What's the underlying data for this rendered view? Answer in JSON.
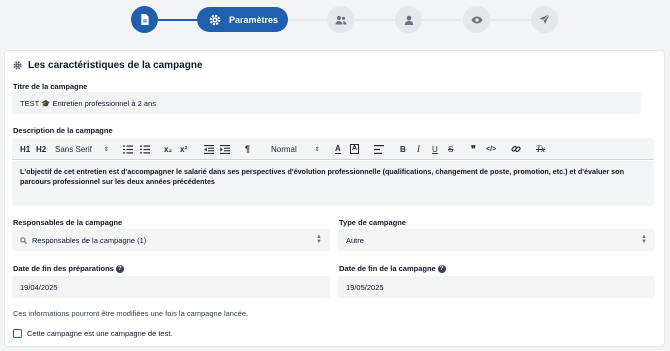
{
  "stepper": {
    "active_step_label": "Paramètres",
    "steps": [
      {
        "icon": "document-icon",
        "state": "completed"
      },
      {
        "icon": "gear-icon",
        "state": "active"
      },
      {
        "icon": "users-icon",
        "state": "pending"
      },
      {
        "icon": "user-icon",
        "state": "pending"
      },
      {
        "icon": "eye-icon",
        "state": "pending"
      },
      {
        "icon": "send-icon",
        "state": "pending"
      }
    ]
  },
  "section": {
    "title": "Les caractéristiques de la campagne"
  },
  "campaign_title": {
    "label": "Titre de la campagne",
    "value": "TEST 🎓 Entretien professionnel à 2 ans"
  },
  "description": {
    "label": "Description de la campagne",
    "value": "L'objectif de cet entretien est d'accompagner le salarié dans ses perspectives d'évolution professionnelle (qualifications, changement de poste, promotion, etc.) et d'évaluer son parcours professionnel sur les deux années précédentes",
    "toolbar": {
      "h1": "H1",
      "h2": "H2",
      "font": "Sans Serif",
      "subscript": "x₂",
      "superscript": "x²",
      "size": "Normal",
      "bold": "B",
      "italic": "I",
      "underline": "U",
      "strike": "S",
      "quote": "❞",
      "code": "</>",
      "clear": "Tx"
    }
  },
  "owners": {
    "label": "Responsables de la campagne",
    "value": "Responsables de la campagne (1)"
  },
  "campaign_type": {
    "label": "Type de campagne",
    "value": "Autre"
  },
  "prep_end": {
    "label": "Date de fin des préparations",
    "value": "19/04/2025"
  },
  "campaign_end": {
    "label": "Date de fin de la campagne",
    "value": "19/05/2025"
  },
  "info_text": "Ces informations pourront être modifiées une fois la campagne lancée.",
  "test_checkbox": {
    "label": "Cette campagne est une campagne de test.",
    "checked": false
  },
  "colors": {
    "primary": "#1f5fae",
    "field_bg": "#f3f4f6",
    "step_inactive": "#e5e7eb"
  }
}
